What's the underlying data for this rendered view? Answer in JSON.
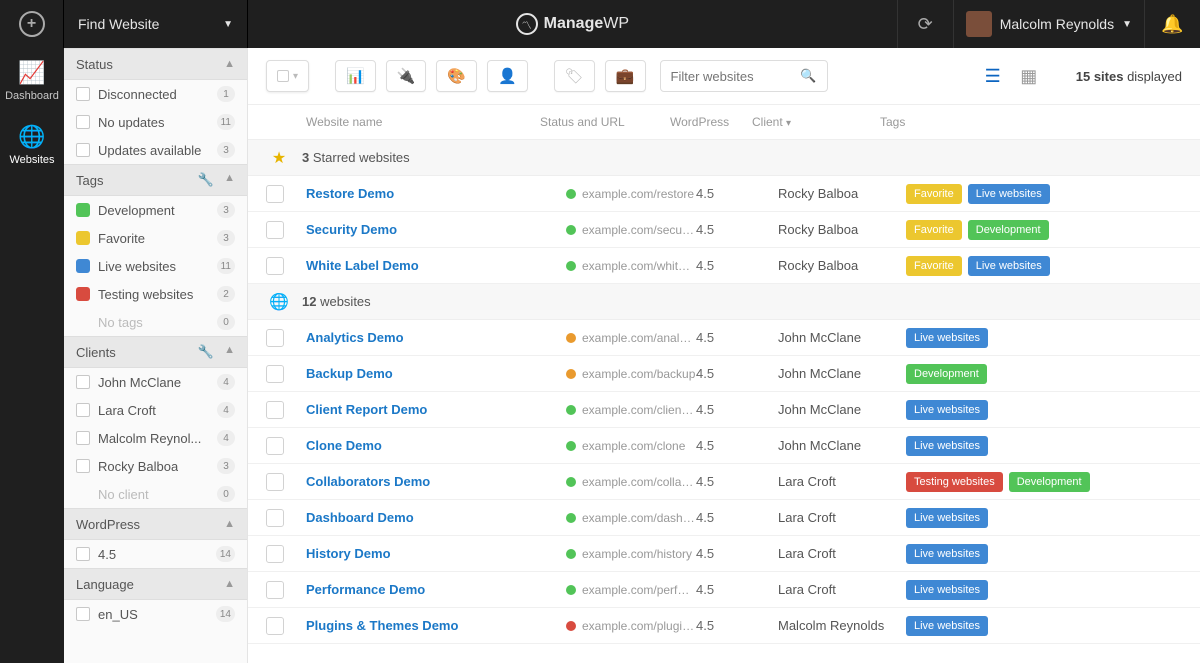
{
  "topbar": {
    "finder_label": "Find Website",
    "brand_prefix": "Manage",
    "brand_suffix": "WP",
    "user_name": "Malcolm Reynolds"
  },
  "rail": {
    "items": [
      {
        "icon": "📈",
        "label": "Dashboard",
        "active": false
      },
      {
        "icon": "🌐",
        "label": "Websites",
        "active": true
      }
    ]
  },
  "sidebar": {
    "groups": [
      {
        "title": "Status",
        "tools": false,
        "items": [
          {
            "type": "cb",
            "label": "Disconnected",
            "count": "1"
          },
          {
            "type": "cb",
            "label": "No updates",
            "count": "11"
          },
          {
            "type": "cb",
            "label": "Updates available",
            "count": "3"
          }
        ]
      },
      {
        "title": "Tags",
        "tools": true,
        "items": [
          {
            "type": "sw",
            "color": "c-green",
            "label": "Development",
            "count": "3"
          },
          {
            "type": "sw",
            "color": "c-yellow",
            "label": "Favorite",
            "count": "3"
          },
          {
            "type": "sw",
            "color": "c-blue",
            "label": "Live websites",
            "count": "11"
          },
          {
            "type": "sw",
            "color": "c-red",
            "label": "Testing websites",
            "count": "2"
          },
          {
            "type": "muted",
            "label": "No tags",
            "count": "0"
          }
        ]
      },
      {
        "title": "Clients",
        "tools": true,
        "items": [
          {
            "type": "cb",
            "label": "John McClane",
            "count": "4"
          },
          {
            "type": "cb",
            "label": "Lara Croft",
            "count": "4"
          },
          {
            "type": "cb",
            "label": "Malcolm Reynol...",
            "count": "4"
          },
          {
            "type": "cb",
            "label": "Rocky Balboa",
            "count": "3"
          },
          {
            "type": "muted",
            "label": "No client",
            "count": "0"
          }
        ]
      },
      {
        "title": "WordPress",
        "tools": false,
        "items": [
          {
            "type": "cb",
            "label": "4.5",
            "count": "14"
          }
        ]
      },
      {
        "title": "Language",
        "tools": false,
        "items": [
          {
            "type": "cb",
            "label": "en_US",
            "count": "14"
          }
        ]
      }
    ]
  },
  "toolbar": {
    "search_placeholder": "Filter websites",
    "count_num": "15 sites",
    "count_suffix": " displayed"
  },
  "columns": {
    "name": "Website name",
    "status": "Status and URL",
    "wp": "WordPress",
    "client": "Client",
    "tags": "Tags"
  },
  "sections": [
    {
      "icon": "star",
      "count": "3",
      "label": " Starred websites"
    },
    {
      "icon": "globe",
      "count": "12",
      "label": " websites"
    }
  ],
  "tag_colors": {
    "Favorite": "c-yellow",
    "Live websites": "c-blue",
    "Development": "c-green",
    "Testing websites": "c-red"
  },
  "rows_starred": [
    {
      "name": "Restore Demo",
      "dot": "dot-green",
      "url": "example.com/restore",
      "wp": "4.5",
      "client": "Rocky Balboa",
      "tags": [
        "Favorite",
        "Live websites"
      ]
    },
    {
      "name": "Security Demo",
      "dot": "dot-green",
      "url": "example.com/securi...",
      "wp": "4.5",
      "client": "Rocky Balboa",
      "tags": [
        "Favorite",
        "Development"
      ]
    },
    {
      "name": "White Label Demo",
      "dot": "dot-green",
      "url": "example.com/white-...",
      "wp": "4.5",
      "client": "Rocky Balboa",
      "tags": [
        "Favorite",
        "Live websites"
      ]
    }
  ],
  "rows_main": [
    {
      "name": "Analytics Demo",
      "dot": "dot-orange",
      "url": "example.com/analyt...",
      "wp": "4.5",
      "client": "John McClane",
      "tags": [
        "Live websites"
      ]
    },
    {
      "name": "Backup Demo",
      "dot": "dot-orange",
      "url": "example.com/backup",
      "wp": "4.5",
      "client": "John McClane",
      "tags": [
        "Development"
      ]
    },
    {
      "name": "Client Report Demo",
      "dot": "dot-green",
      "url": "example.com/client-...",
      "wp": "4.5",
      "client": "John McClane",
      "tags": [
        "Live websites"
      ]
    },
    {
      "name": "Clone Demo",
      "dot": "dot-green",
      "url": "example.com/clone",
      "wp": "4.5",
      "client": "John McClane",
      "tags": [
        "Live websites"
      ]
    },
    {
      "name": "Collaborators Demo",
      "dot": "dot-green",
      "url": "example.com/collab...",
      "wp": "4.5",
      "client": "Lara Croft",
      "tags": [
        "Testing websites",
        "Development"
      ]
    },
    {
      "name": "Dashboard Demo",
      "dot": "dot-green",
      "url": "example.com/dashb...",
      "wp": "4.5",
      "client": "Lara Croft",
      "tags": [
        "Live websites"
      ]
    },
    {
      "name": "History Demo",
      "dot": "dot-green",
      "url": "example.com/history",
      "wp": "4.5",
      "client": "Lara Croft",
      "tags": [
        "Live websites"
      ]
    },
    {
      "name": "Performance Demo",
      "dot": "dot-green",
      "url": "example.com/perfor...",
      "wp": "4.5",
      "client": "Lara Croft",
      "tags": [
        "Live websites"
      ]
    },
    {
      "name": "Plugins & Themes Demo",
      "dot": "dot-red",
      "url": "example.com/plugin...",
      "wp": "4.5",
      "client": "Malcolm Reynolds",
      "tags": [
        "Live websites"
      ]
    }
  ]
}
